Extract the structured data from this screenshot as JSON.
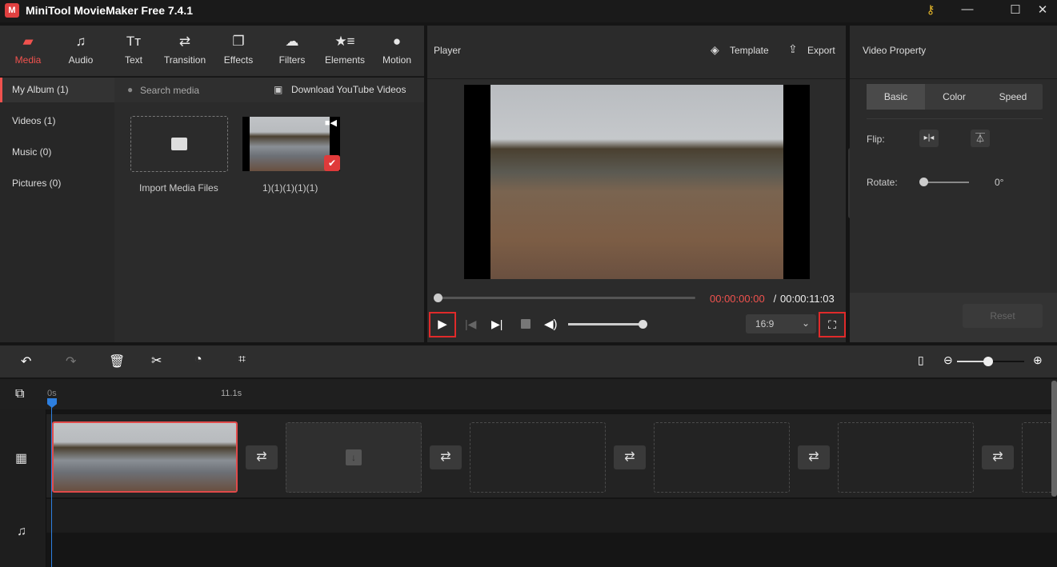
{
  "app": {
    "title": "MiniTool MovieMaker Free 7.4.1",
    "logo_text": "M"
  },
  "nav": [
    {
      "label": "Media",
      "icon": "folder-icon",
      "glyph": "▰"
    },
    {
      "label": "Audio",
      "icon": "music-icon",
      "glyph": "♫"
    },
    {
      "label": "Text",
      "icon": "text-icon",
      "glyph": "Tт"
    },
    {
      "label": "Transition",
      "icon": "transition-icon",
      "glyph": "⇄"
    },
    {
      "label": "Effects",
      "icon": "effects-icon",
      "glyph": "❐"
    },
    {
      "label": "Filters",
      "icon": "filters-icon",
      "glyph": "☁"
    },
    {
      "label": "Elements",
      "icon": "elements-icon",
      "glyph": "★≡"
    },
    {
      "label": "Motion",
      "icon": "motion-icon",
      "glyph": "●"
    }
  ],
  "sidebar": [
    {
      "label": "My Album (1)"
    },
    {
      "label": "Videos (1)"
    },
    {
      "label": "Music (0)"
    },
    {
      "label": "Pictures (0)"
    }
  ],
  "media": {
    "search_placeholder": "Search media",
    "download_label": "Download YouTube Videos",
    "import_label": "Import Media Files",
    "clip_name": "1)(1)(1)(1)(1)"
  },
  "player": {
    "title": "Player",
    "template_label": "Template",
    "export_label": "Export",
    "current_time": "00:00:00:00",
    "separator": " / ",
    "total_time": "00:00:11:03",
    "aspect_ratio": "16:9",
    "progress": 0,
    "volume": 1.0
  },
  "property": {
    "title": "Video Property",
    "tabs": [
      "Basic",
      "Color",
      "Speed"
    ],
    "active_tab": "Basic",
    "flip_label": "Flip:",
    "rotate_label": "Rotate:",
    "rotate_value": "0°",
    "reset_label": "Reset"
  },
  "timeline": {
    "ruler_start": "0s",
    "ruler_mark": "11.1s",
    "zoom_level": 0.45
  },
  "colors": {
    "accent": "#f0524e",
    "highlight_box": "#e02a2a",
    "playhead": "#2d7fe0"
  }
}
